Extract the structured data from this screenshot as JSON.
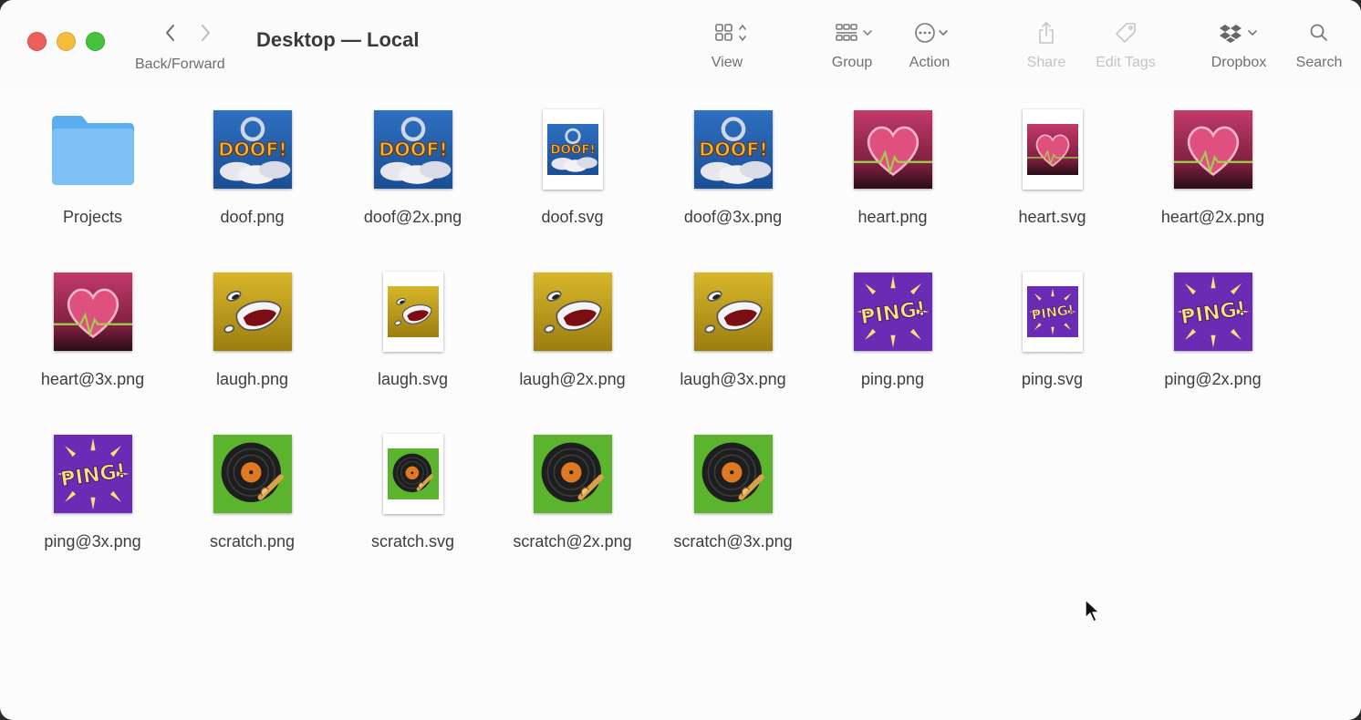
{
  "window": {
    "title": "Desktop — Local",
    "nav_label": "Back/Forward"
  },
  "toolbar": {
    "view": "View",
    "group": "Group",
    "action": "Action",
    "share": "Share",
    "edit_tags": "Edit Tags",
    "dropbox": "Dropbox",
    "search": "Search"
  },
  "files": [
    {
      "name": "Projects",
      "kind": "folder"
    },
    {
      "name": "doof.png",
      "kind": "png",
      "art": "doof"
    },
    {
      "name": "doof@2x.png",
      "kind": "png",
      "art": "doof"
    },
    {
      "name": "doof.svg",
      "kind": "svg",
      "art": "doof"
    },
    {
      "name": "doof@3x.png",
      "kind": "png",
      "art": "doof"
    },
    {
      "name": "heart.png",
      "kind": "png",
      "art": "heart"
    },
    {
      "name": "heart.svg",
      "kind": "svg",
      "art": "heart"
    },
    {
      "name": "heart@2x.png",
      "kind": "png",
      "art": "heart"
    },
    {
      "name": "heart@3x.png",
      "kind": "png",
      "art": "heart"
    },
    {
      "name": "laugh.png",
      "kind": "png",
      "art": "laugh"
    },
    {
      "name": "laugh.svg",
      "kind": "svg",
      "art": "laugh"
    },
    {
      "name": "laugh@2x.png",
      "kind": "png",
      "art": "laugh"
    },
    {
      "name": "laugh@3x.png",
      "kind": "png",
      "art": "laugh"
    },
    {
      "name": "ping.png",
      "kind": "png",
      "art": "ping"
    },
    {
      "name": "ping.svg",
      "kind": "svg",
      "art": "ping"
    },
    {
      "name": "ping@2x.png",
      "kind": "png",
      "art": "ping"
    },
    {
      "name": "ping@3x.png",
      "kind": "png",
      "art": "ping"
    },
    {
      "name": "scratch.png",
      "kind": "png",
      "art": "scratch"
    },
    {
      "name": "scratch.svg",
      "kind": "svg",
      "art": "scratch"
    },
    {
      "name": "scratch@2x.png",
      "kind": "png",
      "art": "scratch"
    },
    {
      "name": "scratch@3x.png",
      "kind": "png",
      "art": "scratch"
    }
  ],
  "art_text": {
    "doof": "DOOF!",
    "ping": "PING!"
  }
}
